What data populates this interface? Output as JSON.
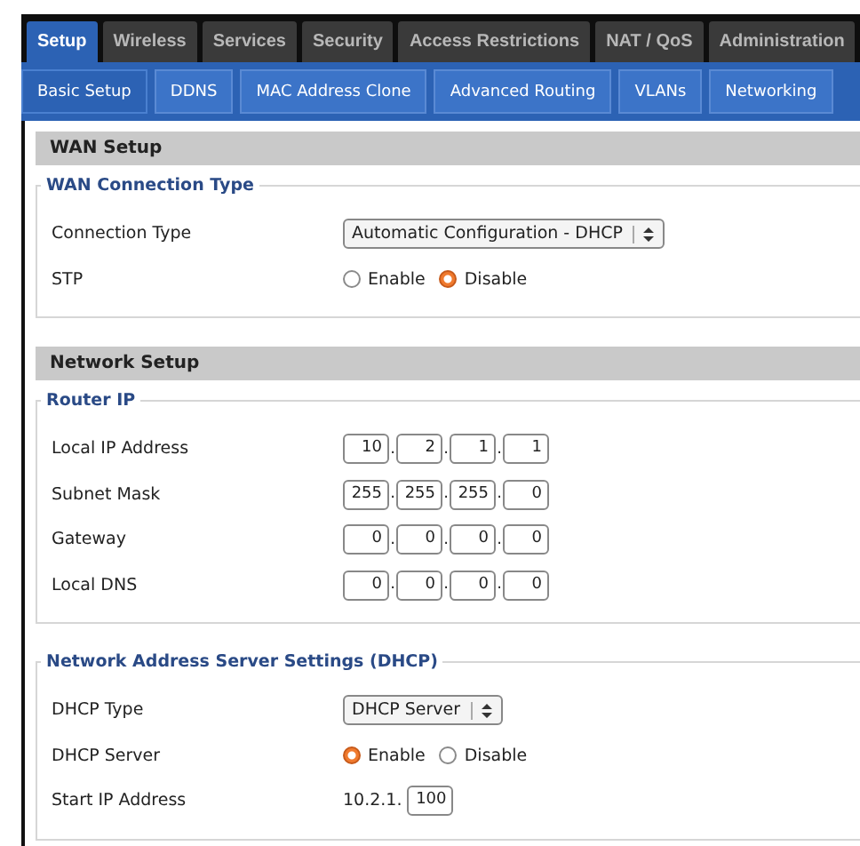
{
  "main_tabs": [
    {
      "label": "Setup",
      "selected": true
    },
    {
      "label": "Wireless",
      "selected": false
    },
    {
      "label": "Services",
      "selected": false
    },
    {
      "label": "Security",
      "selected": false
    },
    {
      "label": "Access Restrictions",
      "selected": false
    },
    {
      "label": "NAT / QoS",
      "selected": false
    },
    {
      "label": "Administration",
      "selected": false
    }
  ],
  "sub_tabs": [
    {
      "label": "Basic Setup",
      "selected": true
    },
    {
      "label": "DDNS",
      "selected": false
    },
    {
      "label": "MAC Address Clone",
      "selected": false
    },
    {
      "label": "Advanced Routing",
      "selected": false
    },
    {
      "label": "VLANs",
      "selected": false
    },
    {
      "label": "Networking",
      "selected": false
    }
  ],
  "sections": [
    {
      "title": "WAN Setup",
      "groups": [
        {
          "legend": "WAN Connection Type",
          "rows": [
            {
              "kind": "select",
              "label": "Connection Type",
              "value": "Automatic Configuration - DHCP"
            },
            {
              "kind": "radio",
              "label": "STP",
              "options": [
                {
                  "label": "Enable",
                  "selected": false
                },
                {
                  "label": "Disable",
                  "selected": true
                }
              ]
            }
          ]
        }
      ]
    },
    {
      "title": "Network Setup",
      "groups": [
        {
          "legend": "Router IP",
          "rows": [
            {
              "kind": "ip",
              "label": "Local IP Address",
              "octets": [
                "10",
                "2",
                "1",
                "1"
              ],
              "separator": "."
            },
            {
              "kind": "ip",
              "label": "Subnet Mask",
              "octets": [
                "255",
                "255",
                "255",
                "0"
              ],
              "separator": "."
            },
            {
              "kind": "ip",
              "label": "Gateway",
              "octets": [
                "0",
                "0",
                "0",
                "0"
              ],
              "separator": "."
            },
            {
              "kind": "ip",
              "label": "Local DNS",
              "octets": [
                "0",
                "0",
                "0",
                "0"
              ],
              "separator": "."
            }
          ]
        },
        {
          "legend": "Network Address Server Settings (DHCP)",
          "rows": [
            {
              "kind": "select",
              "label": "DHCP Type",
              "value": "DHCP Server"
            },
            {
              "kind": "radio",
              "label": "DHCP Server",
              "options": [
                {
                  "label": "Enable",
                  "selected": true
                },
                {
                  "label": "Disable",
                  "selected": false
                }
              ]
            },
            {
              "kind": "prefix_input",
              "label": "Start IP Address",
              "prefix": "10.2.1.",
              "value": "100"
            }
          ]
        }
      ]
    }
  ]
}
